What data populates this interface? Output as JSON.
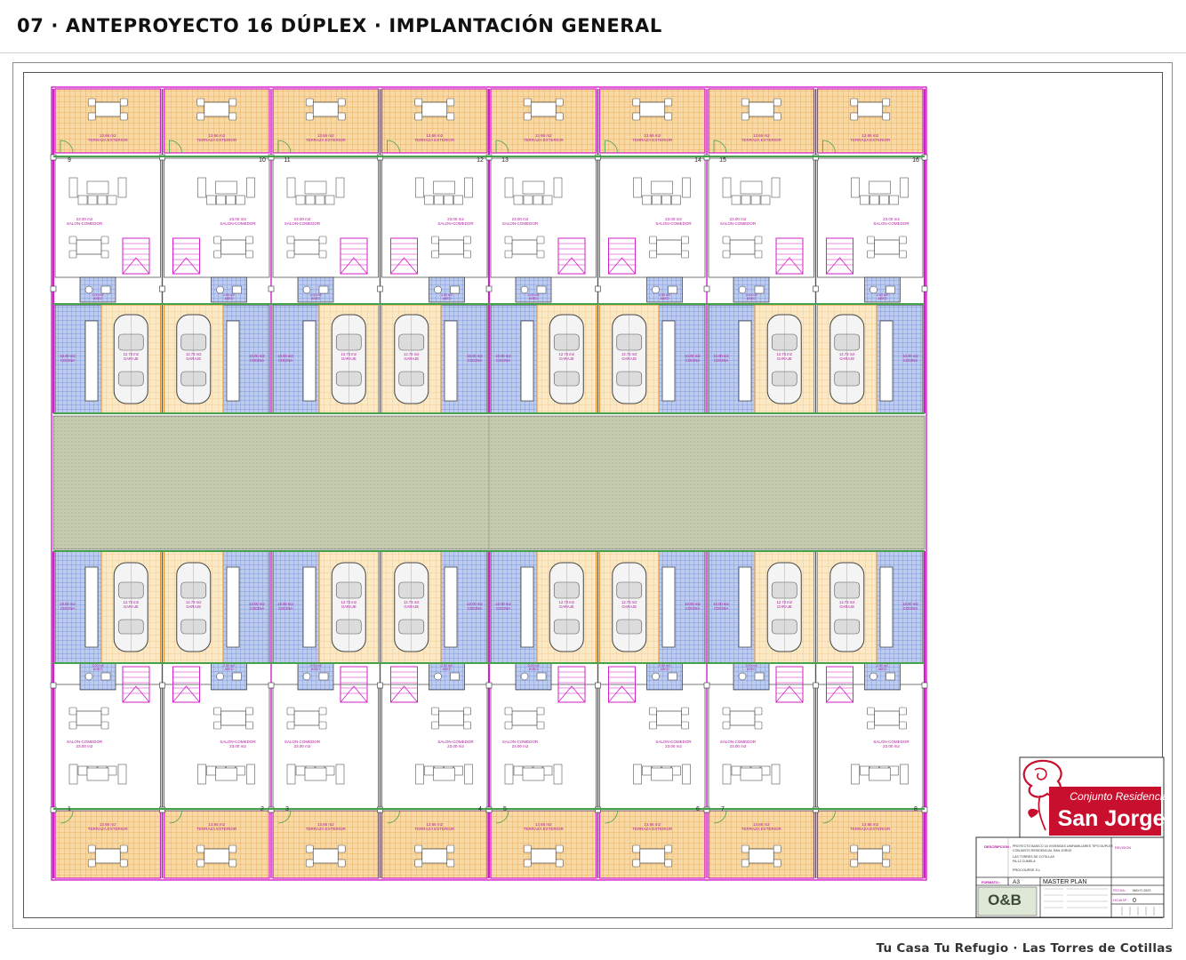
{
  "page": {
    "title": "07 · ANTEPROYECTO 16 DÚPLEX · IMPLANTACIÓN GENERAL",
    "footer": "Tu Casa Tu Refugio · Las Torres de Cotillas"
  },
  "plan": {
    "top_unit_numbers": [
      "9",
      "10",
      "11",
      "12",
      "13",
      "14",
      "15",
      "16"
    ],
    "bottom_unit_numbers": [
      "1",
      "2",
      "3",
      "4",
      "5",
      "6",
      "7",
      "8"
    ],
    "labels": {
      "terrace_area": "13.66 m2",
      "terrace": "TERRAZA EXTERIOR",
      "living_area": "23.00 m2",
      "living": "SALON-COMEDOR",
      "garage_area": "12.73 m2",
      "garage": "GARAJE",
      "kitchen_area": "10.00 m2",
      "kitchen": "COCINA",
      "wc_area": "2.00 m2",
      "wc": "ASEO"
    },
    "colors": {
      "terrace": "#f6d9a6",
      "terrace_grid": "#e0902a",
      "wall": "#44a24a",
      "magenta": "#d21fc8",
      "kitchen": "#b7c9f0",
      "kitchen_grid": "#4a6fd0",
      "garage": "#fbe6bf",
      "street": "#c9cfb4",
      "label": "#b0189e",
      "logo_red": "#c8102e"
    }
  },
  "title_block": {
    "brand_line1": "Conjunto Residencial",
    "brand_line2": "San Jorge",
    "descripcion_label": "DESCRIPCION :",
    "descripcion_lines": [
      "PROYECTO BASICO 16 VIVIENDAS UNIFAMILIARES TIPO DUPLEX",
      "CONJUNTO RESIDENCIAL SAN JORGE",
      "LAS TORRES DE COTILLAS",
      "PA-12 CUMELA"
    ],
    "promotor": "PROCOURSE S.L.",
    "formato_label": "FORMATO :",
    "formato": "A3",
    "plano_label": "PLANO :",
    "plano": "MASTER PLAN",
    "fecha_label": "FECHA :",
    "fecha": "MAYO 2023",
    "revision_label": "REVISION",
    "hoja_label": "HOJA Nº :",
    "hoja": "0",
    "office_logo": "O&B"
  }
}
